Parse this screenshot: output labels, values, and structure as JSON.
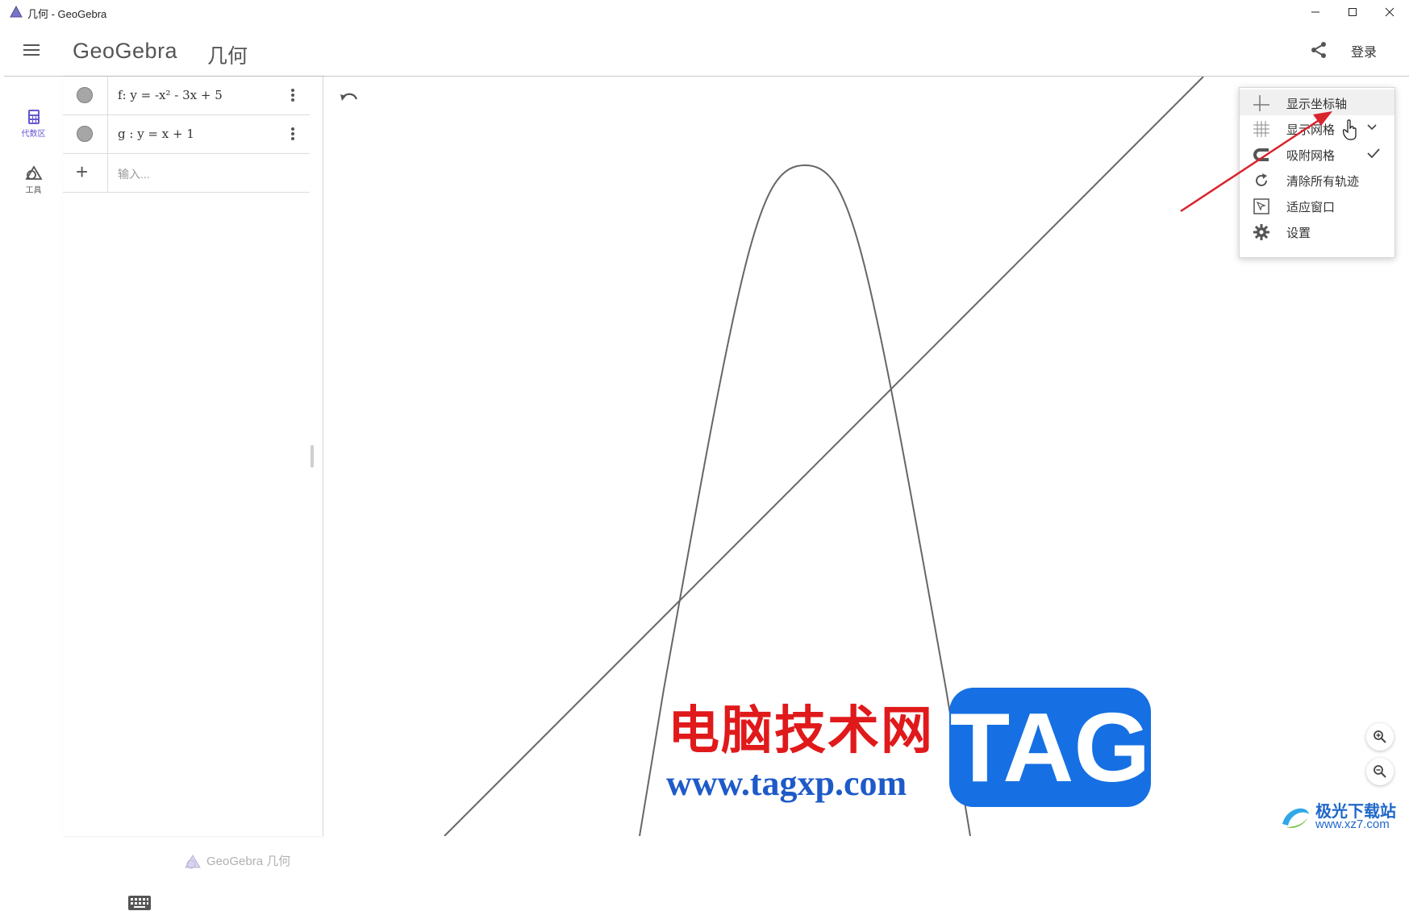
{
  "window": {
    "title": "几何 - GeoGebra"
  },
  "header": {
    "logo": "GeoGebra",
    "app_name": "几何",
    "login_label": "登录"
  },
  "rail": {
    "items": [
      {
        "label": "代数区",
        "icon": "calculator-icon",
        "active": true
      },
      {
        "label": "工具",
        "icon": "geometry-tools-icon",
        "active": false
      }
    ]
  },
  "algebra": {
    "rows": [
      {
        "expression": "f: y = -x² - 3x + 5",
        "visible": true
      },
      {
        "expression": "g : y = x + 1",
        "visible": true
      }
    ],
    "input_placeholder": "输入...",
    "footer_brand": "GeoGebra 几何"
  },
  "context_menu": {
    "items": [
      {
        "label": "显示坐标轴",
        "icon": "axes-icon",
        "checked": false,
        "hovered": true
      },
      {
        "label": "显示网格",
        "icon": "grid-icon",
        "submenu": true
      },
      {
        "label": "吸附网格",
        "icon": "magnet-icon",
        "checked": true
      },
      {
        "label": "清除所有轨迹",
        "icon": "refresh-icon"
      },
      {
        "label": "适应窗口",
        "icon": "fit-window-icon"
      },
      {
        "label": "设置",
        "icon": "gear-icon"
      }
    ]
  },
  "colors": {
    "accent": "#6557d2",
    "curve": "#666666",
    "annotation_arrow": "#d9232d"
  },
  "watermark": {
    "cn_text": "电脑技术网",
    "url": "www.tagxp.com",
    "tag": "TAG",
    "site_name": "极光下载站",
    "site_url": "www.xz7.com"
  }
}
